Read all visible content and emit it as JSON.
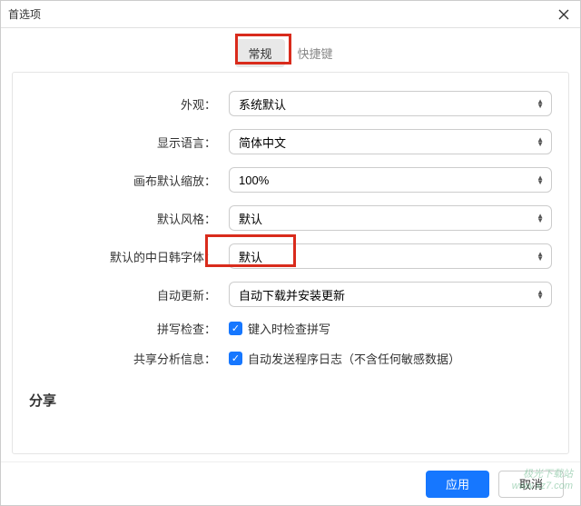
{
  "window": {
    "title": "首选项"
  },
  "tabs": {
    "general": "常规",
    "shortcuts": "快捷键"
  },
  "labels": {
    "appearance": "外观：",
    "language": "显示语言：",
    "zoom": "画布默认缩放：",
    "style": "默认风格：",
    "cjkfont": "默认的中日韩字体：",
    "autoupdate": "自动更新：",
    "spellcheck": "拼写检查：",
    "analytics": "共享分析信息："
  },
  "values": {
    "appearance": "系统默认",
    "language": "简体中文",
    "zoom": "100%",
    "style": "默认",
    "cjkfont": "默认",
    "autoupdate": "自动下载并安装更新"
  },
  "checkboxes": {
    "spellcheck_label": "键入时检查拼写",
    "analytics_label": "自动发送程序日志（不含任何敏感数据）"
  },
  "section": {
    "share": "分享"
  },
  "footer": {
    "apply": "应用",
    "cancel": "取消"
  },
  "watermark": {
    "line1": "极光下载站",
    "line2": "www.xz7.com"
  }
}
